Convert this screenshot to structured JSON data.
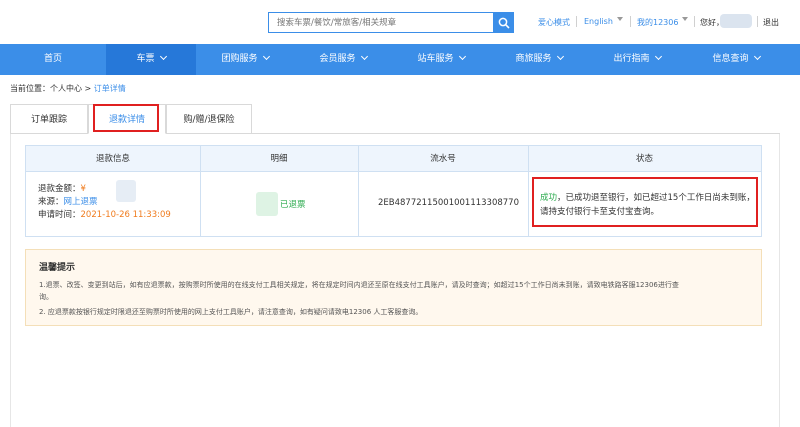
{
  "header": {
    "search_placeholder": "搜索车票/餐饮/常旅客/相关规章",
    "care_mode": "爱心模式",
    "language": "English",
    "my12306": "我的12306",
    "greeting": "您好，",
    "logout": "退出"
  },
  "nav": {
    "items": [
      {
        "label": "首页",
        "has_caret": false
      },
      {
        "label": "车票",
        "has_caret": true,
        "active": true
      },
      {
        "label": "团购服务",
        "has_caret": true
      },
      {
        "label": "会员服务",
        "has_caret": true
      },
      {
        "label": "站车服务",
        "has_caret": true
      },
      {
        "label": "商旅服务",
        "has_caret": true
      },
      {
        "label": "出行指南",
        "has_caret": true
      },
      {
        "label": "信息查询",
        "has_caret": true
      }
    ]
  },
  "breadcrumb": {
    "prefix": "当前位置：个人中心 > ",
    "current": "订单详情"
  },
  "tabs": [
    {
      "label": "订单跟踪"
    },
    {
      "label": "退款详情",
      "active": true
    },
    {
      "label": "购/赠/退保险"
    }
  ],
  "table": {
    "headers": [
      "退款信息",
      "明细",
      "流水号",
      "状态"
    ],
    "row": {
      "amount_label": "退款金额：",
      "amount_value": "¥",
      "source_label": "来源：",
      "source_value": "网上退票",
      "time_label": "申请时间：",
      "time_value": "2021-10-26 11:33:09",
      "detail": "已退票",
      "serial": "2EB487721150010011133087​70",
      "status_ok": "成功",
      "status_text": "，已成功退至银行，如已超过15个工作日尚未到账，请持支付银行卡至支付宝查询。"
    }
  },
  "tips": {
    "title": "温馨提示",
    "items": [
      "1.退票、改签、变更到站后，如有应退票款，按购票时所使用的在线支付工具相关规定，将在规定时间内退还至原在线支付工具账户，请及时查询；如超过15个工作日尚未到账，请致电铁路客服12306进行查",
      "询。",
      "2. 应退票款按银行规定时限退还至购票时所使用的网上支付工具账户，请注意查询，如有疑问请致电12306 人工客服查询。"
    ]
  },
  "colors": {
    "brand_blue": "#3b8ee8",
    "success_green": "#2dab4f",
    "highlight_red": "#e02020",
    "time_orange": "#f07c1e"
  }
}
